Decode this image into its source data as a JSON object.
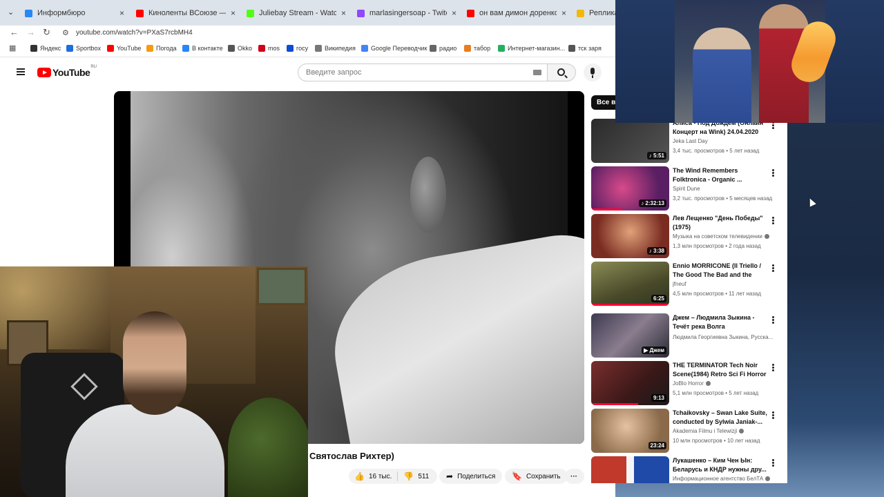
{
  "browser": {
    "tabs": [
      {
        "label": "Информбюро",
        "color": "#2787f5"
      },
      {
        "label": "Киноленты ВСоюзе — смотреть",
        "color": "#ff0000"
      },
      {
        "label": "Juliebay Stream - Watch Live on",
        "color": "#53fc18"
      },
      {
        "label": "marlasingersoap - Twitch",
        "color": "#9146ff"
      },
      {
        "label": "он вам димон доренко - YouTube",
        "color": "#ff0000"
      },
      {
        "label": "Реплика Дем",
        "color": "#f2b90c"
      }
    ],
    "url": "youtube.com/watch?v=PXaS7rcbMH4",
    "bookmarks": [
      {
        "label": "Яндекс",
        "color": "#333333"
      },
      {
        "label": "Sportbox",
        "color": "#1e6fd9"
      },
      {
        "label": "YouTube",
        "color": "#ff0000"
      },
      {
        "label": "Погода",
        "color": "#f39c12"
      },
      {
        "label": "В контакте",
        "color": "#2787f5"
      },
      {
        "label": "Okko",
        "color": "#555555"
      },
      {
        "label": "mos",
        "color": "#d0021b"
      },
      {
        "label": "госу",
        "color": "#0d4cd3"
      },
      {
        "label": "Википедия",
        "color": "#777777"
      },
      {
        "label": "Google Переводчик",
        "color": "#4285f4"
      },
      {
        "label": "радио",
        "color": "#666666"
      },
      {
        "label": "табор",
        "color": "#e67e22"
      },
      {
        "label": "Интернет-магазин...",
        "color": "#27ae60"
      },
      {
        "label": "тск заря",
        "color": "#555555"
      }
    ]
  },
  "youtube": {
    "logo_text": "YouTube",
    "region": "RU",
    "search_placeholder": "Введите запрос",
    "video_title": "Святослав Рихтер)",
    "likes": "16 тыс.",
    "dislikes": "511",
    "share_label": "Поделиться",
    "save_label": "Сохранить",
    "chip_label": "Все ви",
    "related": [
      {
        "title": "Алиса - Под Дождём (Онлайн Концерт на Wink) 24.04.2020",
        "channel": "Jeka Last Day",
        "meta": "3,4 тыс. просмотров • 5 лет назад",
        "duration": "♪ 5:51",
        "verified": false,
        "thumb": "#2a2a2a",
        "progress": 0
      },
      {
        "title": "The Wind Remembers Folktronica - Organic ...",
        "channel": "Spirit Dune",
        "meta": "3,2 тыс. просмотров • 5 месяцев назад",
        "duration": "♪ 2:32:13",
        "verified": false,
        "thumb": "#8a2c6e",
        "progress": 0.4
      },
      {
        "title": "Лев Лещенко \"День Победы\" (1975)",
        "channel": "Музыка на советском телевидении",
        "meta": "1,3 млн просмотров • 2 года назад",
        "duration": "♪ 3:38",
        "verified": true,
        "thumb": "#a45a3c",
        "progress": 0
      },
      {
        "title": "Ennio MORRICONE (Il Triello / The Good The Bad and the Ugl...",
        "channel": "jfneuf",
        "meta": "4,5 млн просмотров • 11 лет назад",
        "duration": "6:25",
        "verified": false,
        "thumb": "#6b6a3a",
        "progress": 1
      },
      {
        "title": "Джем – Людмила Зыкина - Течёт река Волга",
        "channel": "Людмила Георгиевна Зыкина, Русска...",
        "meta": "",
        "duration": "▶ Джем",
        "verified": false,
        "thumb": "#4a4658",
        "progress": 0
      },
      {
        "title": "THE TERMINATOR Tech Noir Scene(1984) Retro Sci Fi Horror",
        "channel": "JoBlo Horror",
        "meta": "5,1 млн просмотров • 5 лет назад",
        "duration": "9:13",
        "verified": true,
        "thumb": "#5a2a2a",
        "progress": 0.6
      },
      {
        "title": "Tchaikovsky – Swan Lake Suite, conducted by Sylwia Janiak-...",
        "channel": "Akademia Filmu i Telewizji",
        "meta": "10 млн просмотров • 10 лет назад",
        "duration": "23:24",
        "verified": true,
        "thumb": "#c9a27c",
        "progress": 0
      },
      {
        "title": "Лукашенко – Ким Чен Ын: Беларусь и КНДР нужны дру...",
        "channel": "Информационное агентство БелТА",
        "meta": "",
        "duration": "",
        "verified": true,
        "thumb": "#b8322e",
        "progress": 0
      }
    ]
  }
}
